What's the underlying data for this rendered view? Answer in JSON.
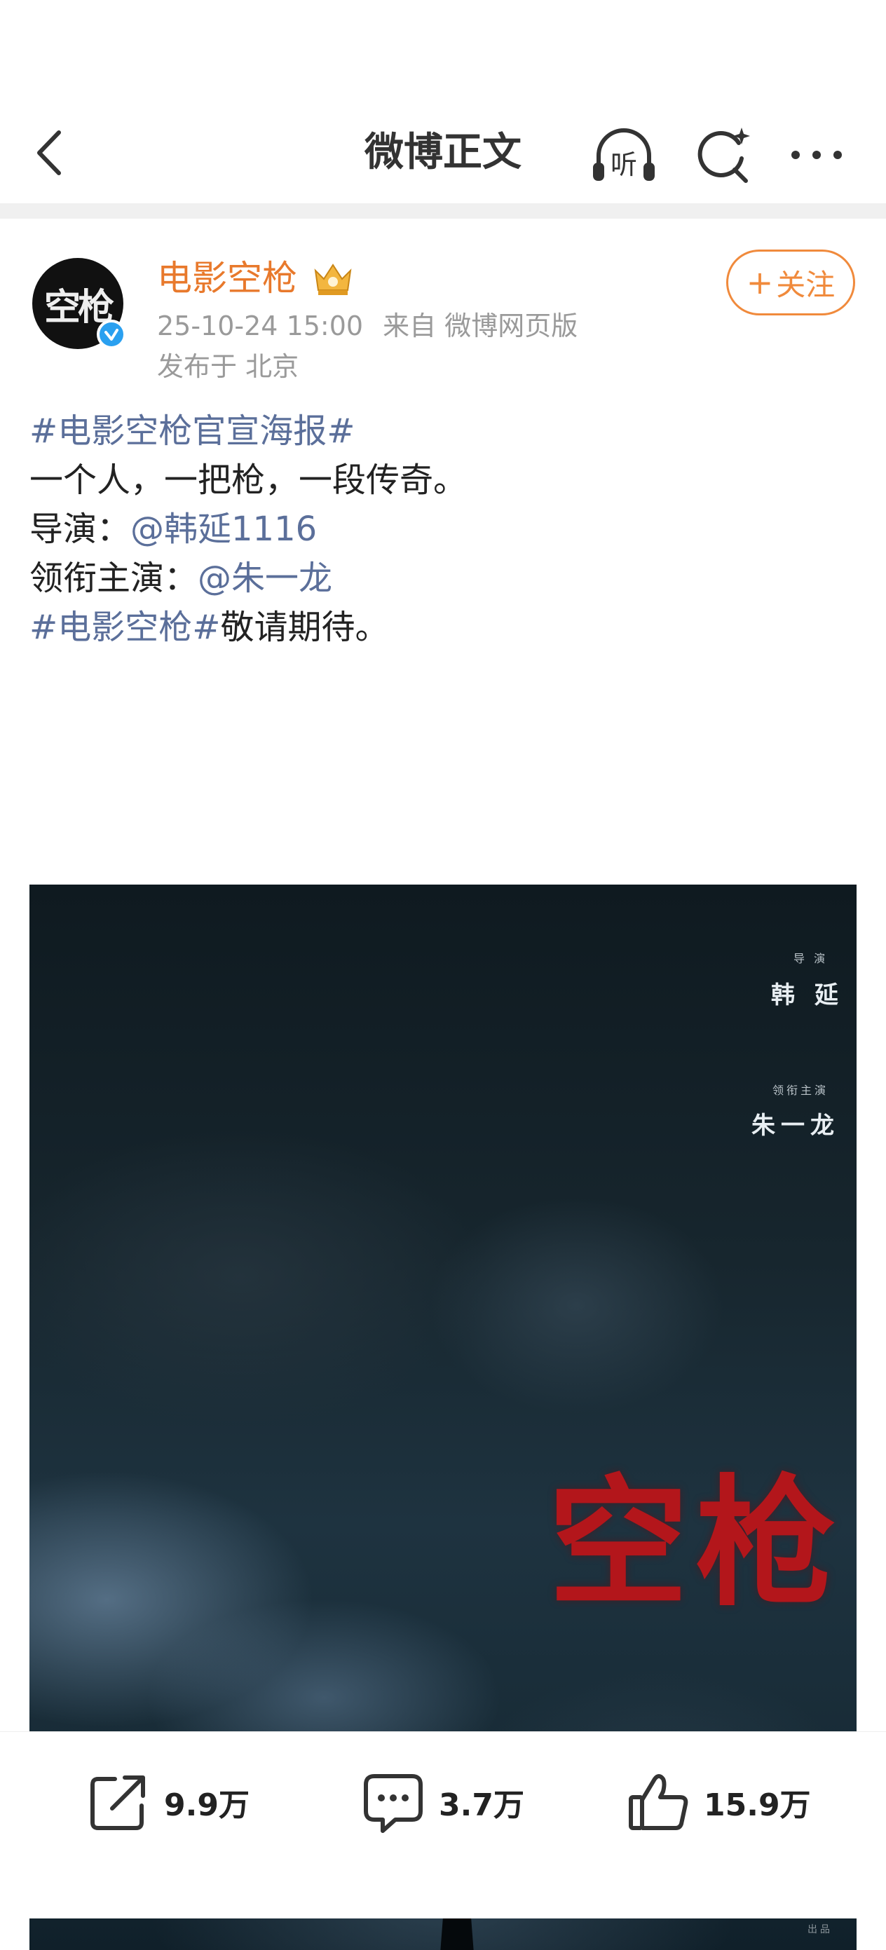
{
  "header": {
    "title": "微博正文",
    "listen_label": "听"
  },
  "post": {
    "author": "电影空枪",
    "avatar_text": "空枪",
    "timestamp": "25-10-24 15:00",
    "source": "来自 微博网页版",
    "location": "发布于 北京",
    "follow_label": "关注",
    "content": {
      "line1_topic": "#电影空枪官宣海报#",
      "line2": "一个人，一把枪，一段传奇。",
      "line3_prefix": "导演：",
      "line3_mention": "@韩延1116",
      "line4_prefix": "领衔主演：",
      "line4_mention": "@朱一龙",
      "line5_topic": "#电影空枪#",
      "line5_suffix": "敬请期待。"
    },
    "poster": {
      "director_label": "导 演",
      "director_name": "韩 延",
      "lead_label": "领衔主演",
      "lead_name": "朱一龙",
      "title": "空枪",
      "corner_mark": "出品"
    }
  },
  "actions": {
    "share_count": "9.9万",
    "comment_count": "3.7万",
    "like_count": "15.9万"
  },
  "colors": {
    "accent_orange": "#f08a3c",
    "link_blue": "#5b6f9a",
    "verified_blue": "#2aa0f0",
    "poster_title_red": "#b3161b"
  }
}
